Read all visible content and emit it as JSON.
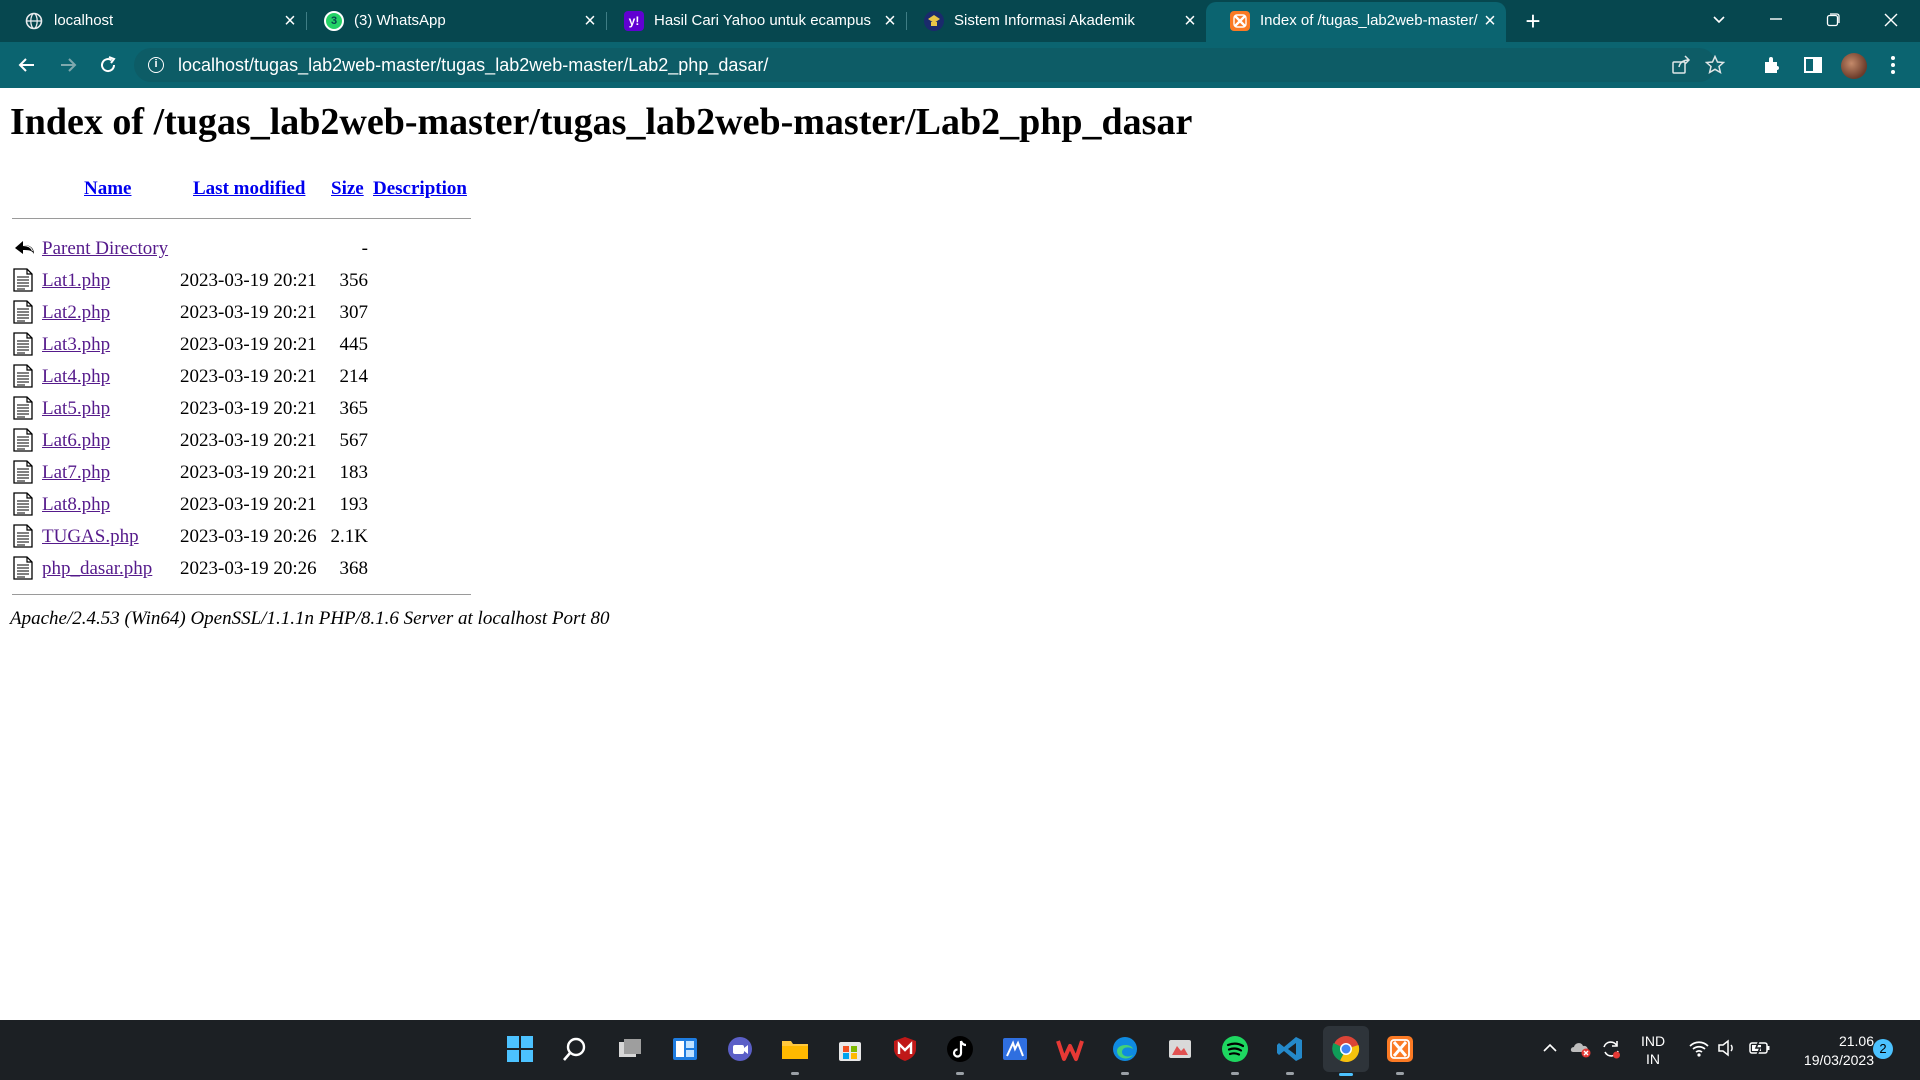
{
  "browser": {
    "tabs": [
      {
        "title": "localhost",
        "favicon": "globe-icon",
        "active": false
      },
      {
        "title": "(3) WhatsApp",
        "favicon": "whatsapp-icon",
        "active": false
      },
      {
        "title": "Hasil Cari Yahoo untuk ecampus",
        "favicon": "yahoo-icon",
        "active": false
      },
      {
        "title": "Sistem Informasi Akademik",
        "favicon": "academic-icon",
        "active": false
      },
      {
        "title": "Index of /tugas_lab2web-master/",
        "favicon": "xampp-icon",
        "active": true
      }
    ],
    "whatsapp_badge": "3",
    "address": "localhost/tugas_lab2web-master/tugas_lab2web-master/Lab2_php_dasar/"
  },
  "page": {
    "heading": "Index of /tugas_lab2web-master/tugas_lab2web-master/Lab2_php_dasar",
    "columns": {
      "name": "Name",
      "last_modified": "Last modified",
      "size": "Size",
      "description": "Description"
    },
    "parent": {
      "name": "Parent Directory",
      "size": "-"
    },
    "files": [
      {
        "name": "Lat1.php",
        "modified": "2023-03-19 20:21",
        "size": "356"
      },
      {
        "name": "Lat2.php",
        "modified": "2023-03-19 20:21",
        "size": "307"
      },
      {
        "name": "Lat3.php",
        "modified": "2023-03-19 20:21",
        "size": "445"
      },
      {
        "name": "Lat4.php",
        "modified": "2023-03-19 20:21",
        "size": "214"
      },
      {
        "name": "Lat5.php",
        "modified": "2023-03-19 20:21",
        "size": "365"
      },
      {
        "name": "Lat6.php",
        "modified": "2023-03-19 20:21",
        "size": "567"
      },
      {
        "name": "Lat7.php",
        "modified": "2023-03-19 20:21",
        "size": "183"
      },
      {
        "name": "Lat8.php",
        "modified": "2023-03-19 20:21",
        "size": "193"
      },
      {
        "name": "TUGAS.php",
        "modified": "2023-03-19 20:26",
        "size": "2.1K"
      },
      {
        "name": "php_dasar.php",
        "modified": "2023-03-19 20:26",
        "size": "368"
      }
    ],
    "server_signature": "Apache/2.4.53 (Win64) OpenSSL/1.1.1n PHP/8.1.6 Server at localhost Port 80"
  },
  "taskbar": {
    "apps": [
      "start-icon",
      "search-icon",
      "task-view-icon",
      "widgets-icon",
      "teams-icon",
      "file-explorer-icon",
      "store-icon",
      "mcafee-icon",
      "tiktok-icon",
      "app-icon",
      "wps-office-icon",
      "edge-icon",
      "app-icon",
      "spotify-icon",
      "vscode-icon",
      "chrome-icon",
      "xampp-icon"
    ],
    "language": "IND",
    "keyboard": "IN",
    "time": "21.06",
    "date": "19/03/2023",
    "notifications": "2"
  },
  "colors": {
    "tabstrip": "#06474f",
    "toolbar": "#0b6470",
    "link": "#0000ee",
    "visited_link": "#551a8b",
    "taskbar": "#1c2024"
  }
}
